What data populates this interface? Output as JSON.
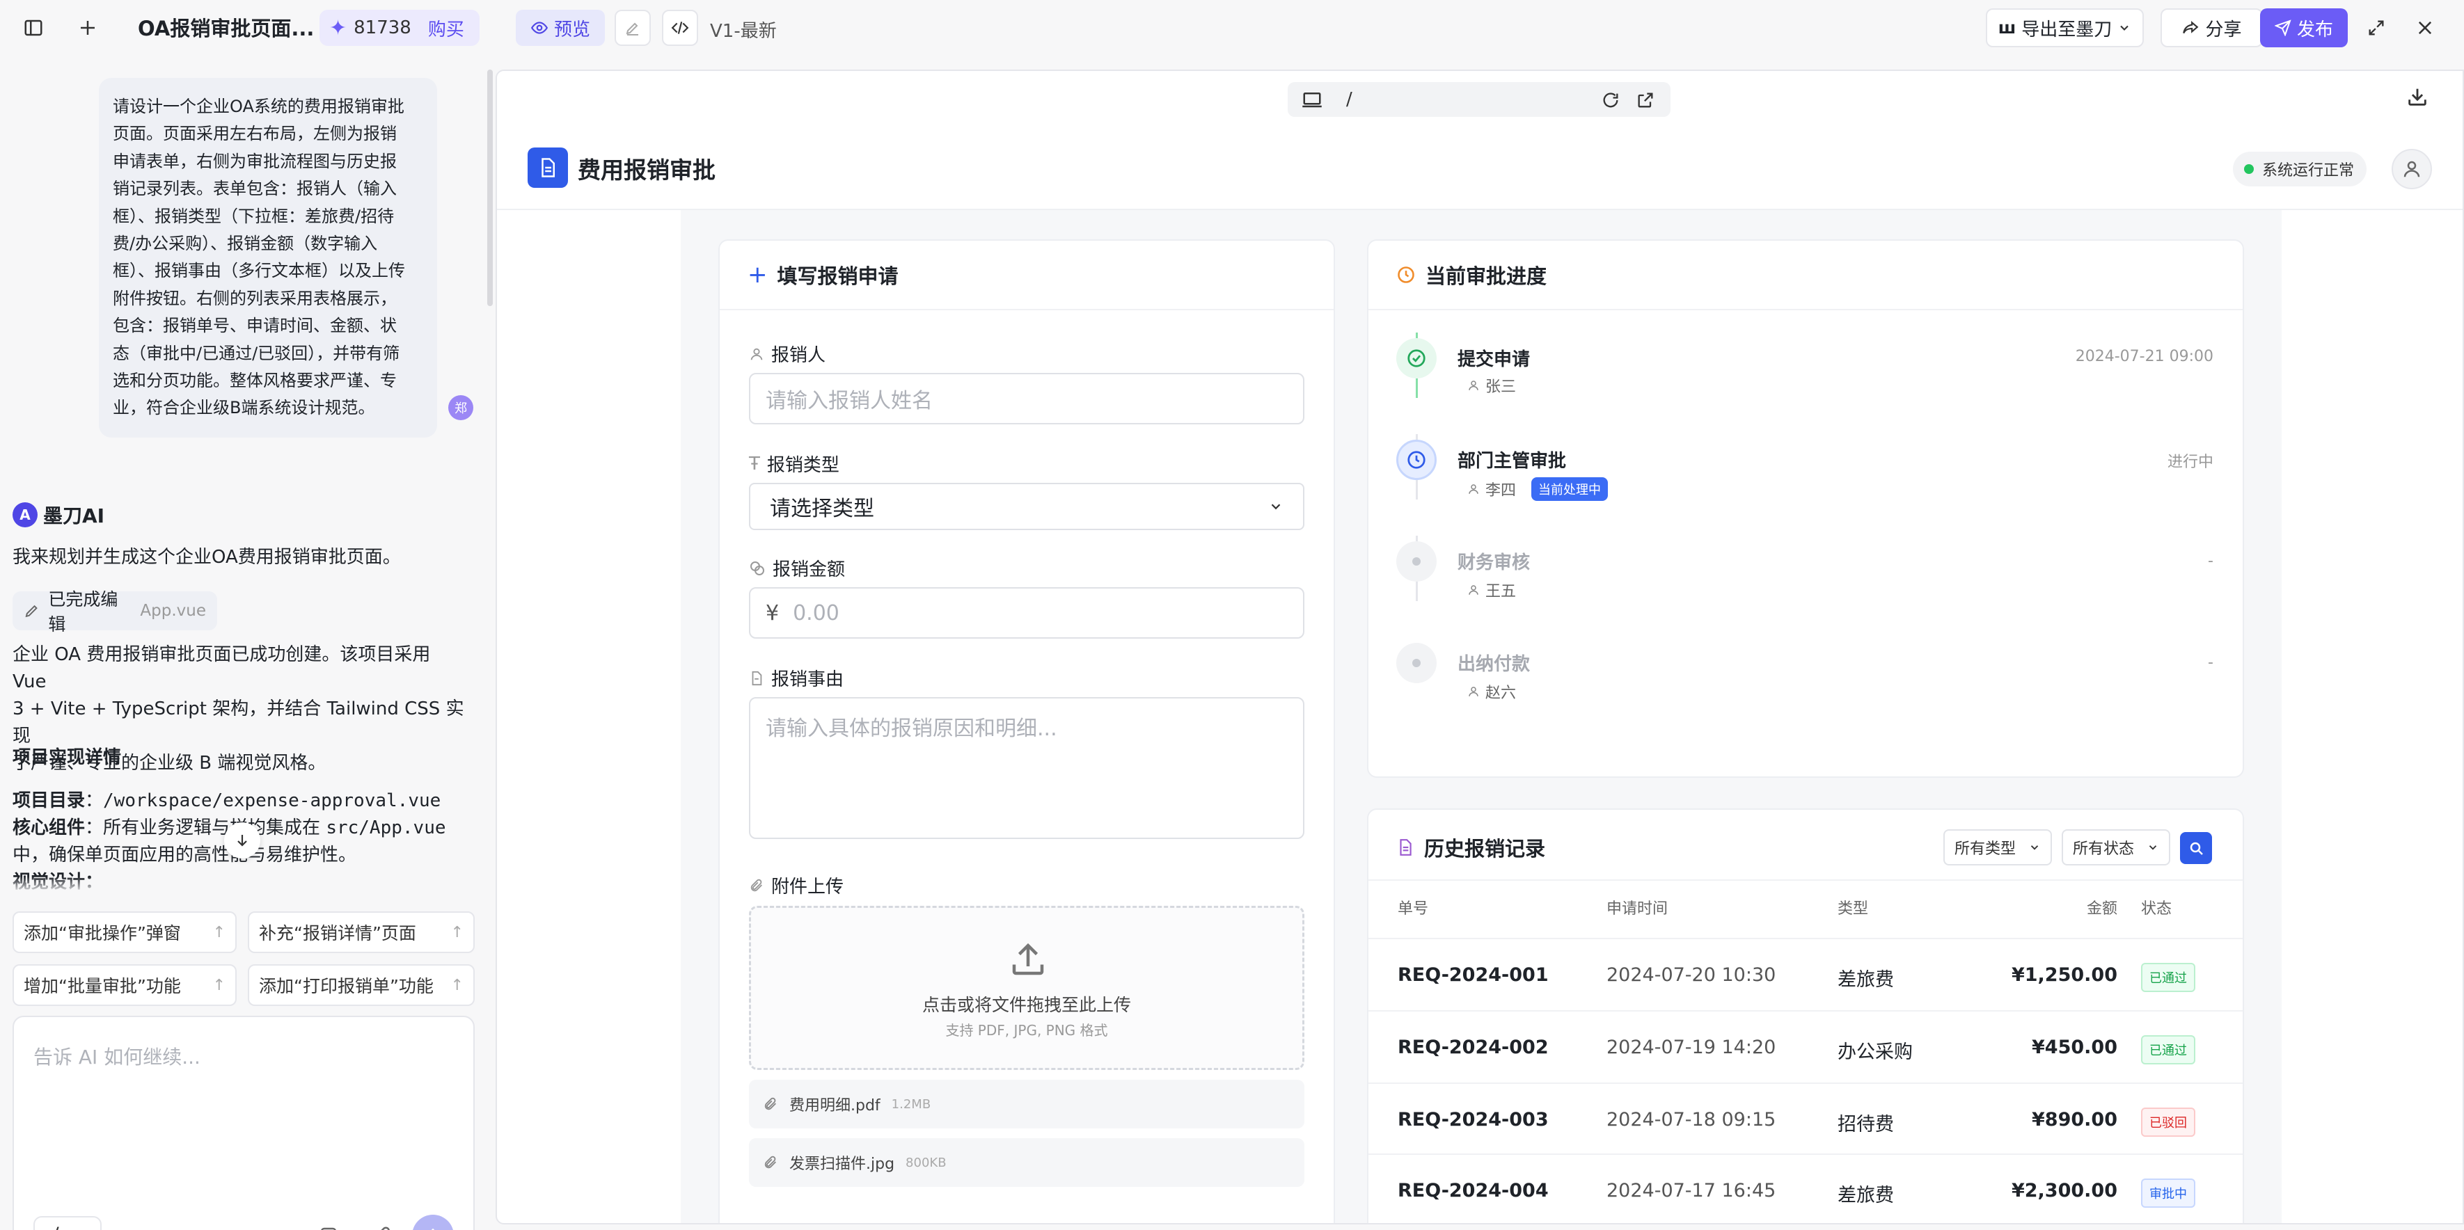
{
  "topbar": {
    "project_title": "OA报销审批页面...",
    "credits": "81738",
    "buy_label": "购买",
    "preview_label": "预览",
    "version": "V1-最新",
    "export_label": "导出至墨刀",
    "share_label": "分享",
    "publish_label": "发布"
  },
  "chat": {
    "user_avatar": "郑",
    "user_message_lines": [
      "请设计一个企业OA系统的费用报销审批",
      "页面。页面采用左右布局，左侧为报销",
      "申请表单，右侧为审批流程图与历史报",
      "销记录列表。表单包含：报销人（输入",
      "框）、报销类型（下拉框：差旅费/招待",
      "费/办公采购）、报销金额（数字输入",
      "框）、报销事由（多行文本框）以及上传",
      "附件按钮。右侧的列表采用表格展示，",
      "包含：报销单号、申请时间、金额、状",
      "态（审批中/已通过/已驳回），并带有筛",
      "选和分页功能。整体风格要求严谨、专",
      "业，符合企业级B端系统设计规范。"
    ],
    "ai_name": "墨刀AI",
    "ai_intro": "我来规划并生成这个企业OA费用报销审批页面。",
    "edit_chip_label": "已完成编辑",
    "edit_chip_file": "App.vue",
    "summary_lines": [
      "企业 OA 费用报销审批页面已成功创建。该项目采用 Vue",
      "3 + Vite + TypeScript 架构，并结合 Tailwind CSS 实现",
      "了严谨、专业的企业级 B 端视觉风格。"
    ],
    "details_title": "项目实现详情",
    "dir_label": "项目目录",
    "dir_value": "/workspace/expense-approval.vue",
    "core_label": "核心组件",
    "core_text_a": "：所有业务逻辑与样",
    "core_text_b": "均集成在",
    "core_code": "src/App.vue",
    "core_line2": "中，确保单页面应用的高性能与易维护性。",
    "cut_line": "视觉设计：",
    "suggestions": [
      "添加“审批操作”弹窗",
      "补充“报销详情”页面",
      "增加“批量审批”功能",
      "添加“打印报销单”功能"
    ],
    "input_placeholder": "告诉 AI 如何继续..."
  },
  "preview": {
    "url": "/",
    "app_title": "费用报销审批",
    "system_status": "系统运行正常",
    "form": {
      "title": "填写报销申请",
      "applicant_label": "报销人",
      "applicant_placeholder": "请输入报销人姓名",
      "type_label": "报销类型",
      "type_value": "请选择类型",
      "amount_label": "报销金额",
      "currency": "¥",
      "amount_placeholder": "0.00",
      "reason_label": "报销事由",
      "reason_placeholder": "请输入具体的报销原因和明细...",
      "upload_label": "附件上传",
      "dropzone_text": "点击或将文件拖拽至此上传",
      "dropzone_hint": "支持 PDF, JPG, PNG 格式",
      "files": [
        {
          "name": "费用明细.pdf",
          "size": "1.2MB"
        },
        {
          "name": "发票扫描件.jpg",
          "size": "800KB"
        }
      ]
    },
    "progress": {
      "title": "当前审批进度",
      "steps": [
        {
          "name": "提交申请",
          "user": "张三",
          "right": "2024-07-21 09:00",
          "state": "done"
        },
        {
          "name": "部门主管审批",
          "user": "李四",
          "badge": "当前处理中",
          "right": "进行中",
          "state": "current"
        },
        {
          "name": "财务审核",
          "user": "王五",
          "right": "-",
          "state": "pending"
        },
        {
          "name": "出纳付款",
          "user": "赵六",
          "right": "-",
          "state": "pending"
        }
      ]
    },
    "history": {
      "title": "历史报销记录",
      "filter_type": "所有类型",
      "filter_status": "所有状态",
      "columns": [
        "单号",
        "申请时间",
        "类型",
        "金额",
        "状态"
      ],
      "rows": [
        {
          "id": "REQ-2024-001",
          "time": "2024-07-20 10:30",
          "type": "差旅费",
          "amount": "¥1,250.00",
          "status": "已通过",
          "kind": "ok"
        },
        {
          "id": "REQ-2024-002",
          "time": "2024-07-19 14:20",
          "type": "办公采购",
          "amount": "¥450.00",
          "status": "已通过",
          "kind": "ok"
        },
        {
          "id": "REQ-2024-003",
          "time": "2024-07-18 09:15",
          "type": "招待费",
          "amount": "¥890.00",
          "status": "已驳回",
          "kind": "rej"
        },
        {
          "id": "REQ-2024-004",
          "time": "2024-07-17 16:45",
          "type": "差旅费",
          "amount": "¥2,300.00",
          "status": "审批中",
          "kind": "pend"
        }
      ]
    }
  }
}
